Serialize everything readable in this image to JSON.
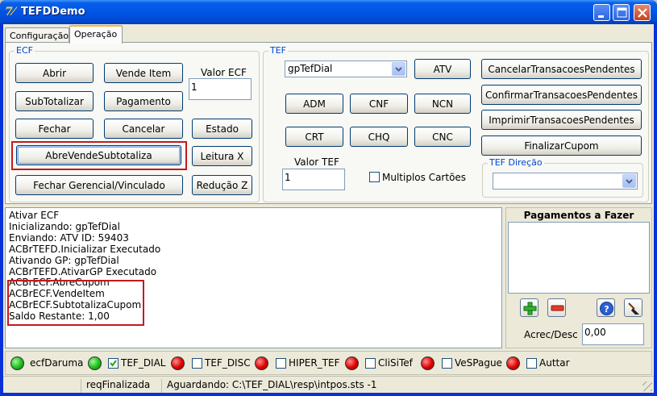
{
  "window": {
    "title": "TEFDDemo"
  },
  "tabs": [
    {
      "label": "Configuração"
    },
    {
      "label": "Operação"
    }
  ],
  "ecf": {
    "title": "ECF",
    "buttons": {
      "abrir": "Abrir",
      "vende_item": "Vende Item",
      "subtotalizar": "SubTotalizar",
      "pagamento": "Pagamento",
      "fechar": "Fechar",
      "cancelar": "Cancelar",
      "estado": "Estado",
      "abre_vende_subtotaliza": "AbreVendeSubtotaliza",
      "leitura_x": "Leitura X",
      "fechar_gerencial": "Fechar Gerencial/Vinculado",
      "reducao_z": "Redução Z"
    },
    "valor_label": "Valor ECF",
    "valor_value": "1"
  },
  "tef": {
    "title": "TEF",
    "gp_selected": "gpTefDial",
    "buttons": {
      "atv": "ATV",
      "adm": "ADM",
      "cnf": "CNF",
      "ncn": "NCN",
      "crt": "CRT",
      "chq": "CHQ",
      "cnc": "CNC",
      "cancelar_pendentes": "CancelarTransacoesPendentes",
      "confirmar_pendentes": "ConfirmarTransacoesPendentes",
      "imprimir_pendentes": "ImprimirTransacoesPendentes",
      "finalizar_cupom": "FinalizarCupom"
    },
    "valor_label": "Valor TEF",
    "valor_value": "1",
    "multiplos_label": "Multiplos Cartões",
    "direcao_title": "TEF Direção",
    "direcao_selected": ""
  },
  "log": {
    "lines": [
      "Ativar ECF",
      "Inicializando: gpTefDial",
      "Enviando: ATV ID: 59403",
      "ACBrTEFD.Inicializar Executado",
      "Ativando GP: gpTefDial",
      "ACBrTEFD.AtivarGP Executado",
      "ACBrECF.AbreCupom",
      "ACBrECF.VendeItem",
      "ACBrECF.SubtotalizaCupom",
      "Saldo Restante: 1,00"
    ]
  },
  "pagamentos": {
    "title": "Pagamentos a Fazer",
    "acrec_label": "Acrec/Desc",
    "acrec_value": "0,00"
  },
  "status_indicators": [
    {
      "label": "ecfDaruma",
      "color": "green",
      "has_check": false
    },
    {
      "label": "TEF_DIAL",
      "color": "green",
      "has_check": true,
      "checked": true
    },
    {
      "label": "TEF_DISC",
      "color": "red",
      "has_check": true,
      "checked": false
    },
    {
      "label": "HIPER_TEF",
      "color": "red",
      "has_check": true,
      "checked": false
    },
    {
      "label": "CliSiTef",
      "color": "red",
      "has_check": true,
      "checked": false
    },
    {
      "label": "VeSPague",
      "color": "red",
      "has_check": true,
      "checked": false
    },
    {
      "label": "Auttar",
      "color": "red",
      "has_check": true,
      "checked": false
    }
  ],
  "statusbar": {
    "panel1": "",
    "panel2": "reqFinalizada",
    "panel3": "Aguardando: C:\\TEF_DIAL\\resp\\intpos.sts -1"
  },
  "colors": {
    "titlebar": "#0055e5",
    "highlight_box": "#c21b1b",
    "led_green": "#19c019",
    "led_red": "#e00000"
  }
}
